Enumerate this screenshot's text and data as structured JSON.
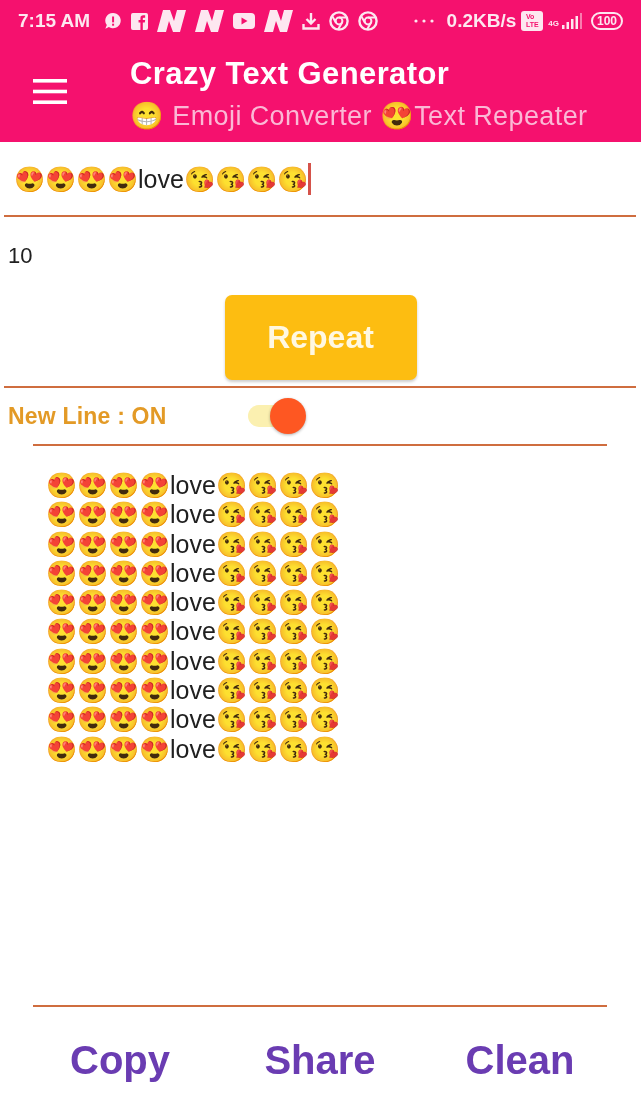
{
  "status_bar": {
    "time": "7:15 AM",
    "notification_icons": [
      {
        "kind": "alert"
      },
      {
        "kind": "facebook"
      },
      {
        "kind": "n-logo"
      },
      {
        "kind": "n-logo"
      },
      {
        "kind": "video"
      },
      {
        "kind": "n-logo"
      },
      {
        "kind": "download"
      },
      {
        "kind": "browser"
      },
      {
        "kind": "browser"
      }
    ],
    "speed": "0.2KB/s",
    "volte": [
      "Vo",
      "LTE"
    ],
    "network": "4G",
    "battery": "100"
  },
  "app_bar": {
    "title": "Crazy Text Generator",
    "subtitle": "😁 Emoji Converter 😍Text Repeater"
  },
  "text_field": {
    "value": "😍😍😍😍love😘😘😘😘"
  },
  "count_field": {
    "value": "10"
  },
  "repeat_button": {
    "label": "Repeat"
  },
  "new_line_toggle": {
    "label": "New Line : ON",
    "on": true
  },
  "output": {
    "lines": [
      "😍😍😍😍love😘😘😘😘",
      "😍😍😍😍love😘😘😘😘",
      "😍😍😍😍love😘😘😘😘",
      "😍😍😍😍love😘😘😘😘",
      "😍😍😍😍love😘😘😘😘",
      "😍😍😍😍love😘😘😘😘",
      "😍😍😍😍love😘😘😘😘",
      "😍😍😍😍love😘😘😘😘",
      "😍😍😍😍love😘😘😘😘",
      "😍😍😍😍love😘😘😘😘"
    ]
  },
  "actions": [
    {
      "label": "Copy"
    },
    {
      "label": "Share"
    },
    {
      "label": "Clean"
    }
  ]
}
